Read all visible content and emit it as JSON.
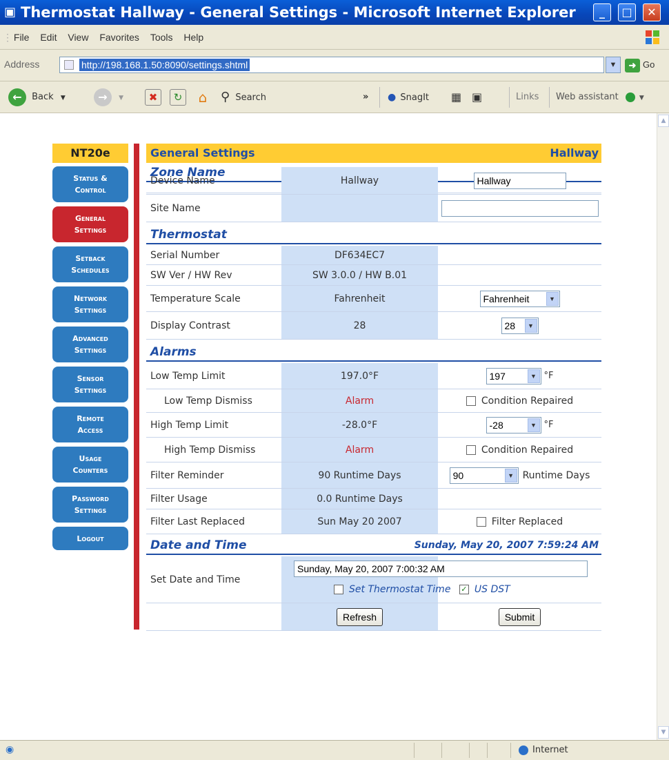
{
  "window": {
    "title": "Thermostat Hallway - General Settings - Microsoft Internet Explorer"
  },
  "menu": [
    "File",
    "Edit",
    "View",
    "Favorites",
    "Tools",
    "Help"
  ],
  "address": {
    "label": "Address",
    "url": "http://198.168.1.50:8090/settings.shtml",
    "go": "Go"
  },
  "toolbar": {
    "back": "Back",
    "search": "Search",
    "snagit": "SnagIt",
    "links": "Links",
    "web_assistant": "Web assistant"
  },
  "status": {
    "zone": "Internet"
  },
  "nav": {
    "title": "NT20e",
    "items": [
      {
        "label": "Status &\nControl",
        "active": false
      },
      {
        "label": "General\nSettings",
        "active": true
      },
      {
        "label": "Setback\nSchedules",
        "active": false
      },
      {
        "label": "Network\nSettings",
        "active": false
      },
      {
        "label": "Advanced\nSettings",
        "active": false
      },
      {
        "label": "Sensor\nSettings",
        "active": false
      },
      {
        "label": "Remote\nAccess",
        "active": false
      },
      {
        "label": "Usage\nCounters",
        "active": false
      },
      {
        "label": "Password\nSettings",
        "active": false
      },
      {
        "label": "Logout",
        "active": false
      }
    ]
  },
  "header": {
    "title": "General Settings",
    "zone": "Hallway"
  },
  "zone_name": {
    "title": "Zone Name",
    "device_name": {
      "label": "Device Name",
      "value": "Hallway",
      "input": "Hallway"
    },
    "site_name": {
      "label": "Site Name",
      "value": "",
      "input": ""
    }
  },
  "thermostat": {
    "title": "Thermostat",
    "serial": {
      "label": "Serial Number",
      "value": "DF634EC7"
    },
    "version": {
      "label": "SW Ver / HW Rev",
      "value": "SW 3.0.0 / HW B.01"
    },
    "scale": {
      "label": "Temperature Scale",
      "value": "Fahrenheit",
      "select": "Fahrenheit"
    },
    "contrast": {
      "label": "Display Contrast",
      "value": "28",
      "select": "28"
    }
  },
  "alarms": {
    "title": "Alarms",
    "low_limit": {
      "label": "Low Temp Limit",
      "value": "197.0°F",
      "select": "197",
      "unit": "°F"
    },
    "low_dismiss": {
      "label": "Low Temp Dismiss",
      "value": "Alarm",
      "check": "Condition Repaired"
    },
    "high_limit": {
      "label": "High Temp Limit",
      "value": "-28.0°F",
      "select": "-28",
      "unit": "°F"
    },
    "high_dismiss": {
      "label": "High Temp Dismiss",
      "value": "Alarm",
      "check": "Condition Repaired"
    },
    "filter_reminder": {
      "label": "Filter Reminder",
      "value": "90 Runtime Days",
      "select": "90",
      "unit": "Runtime Days"
    },
    "filter_usage": {
      "label": "Filter Usage",
      "value": "0.0 Runtime Days"
    },
    "filter_replaced": {
      "label": "Filter Last Replaced",
      "value": "Sun May 20 2007",
      "check": "Filter Replaced"
    }
  },
  "datetime": {
    "title": "Date and Time",
    "current": "Sunday, May 20, 2007 7:59:24 AM",
    "set": {
      "label": "Set Date and Time",
      "input": "Sunday, May 20, 2007 7:00:32 AM",
      "set_thermostat": "Set Thermostat Time",
      "us_dst": "US DST"
    },
    "refresh": "Refresh",
    "submit": "Submit"
  }
}
